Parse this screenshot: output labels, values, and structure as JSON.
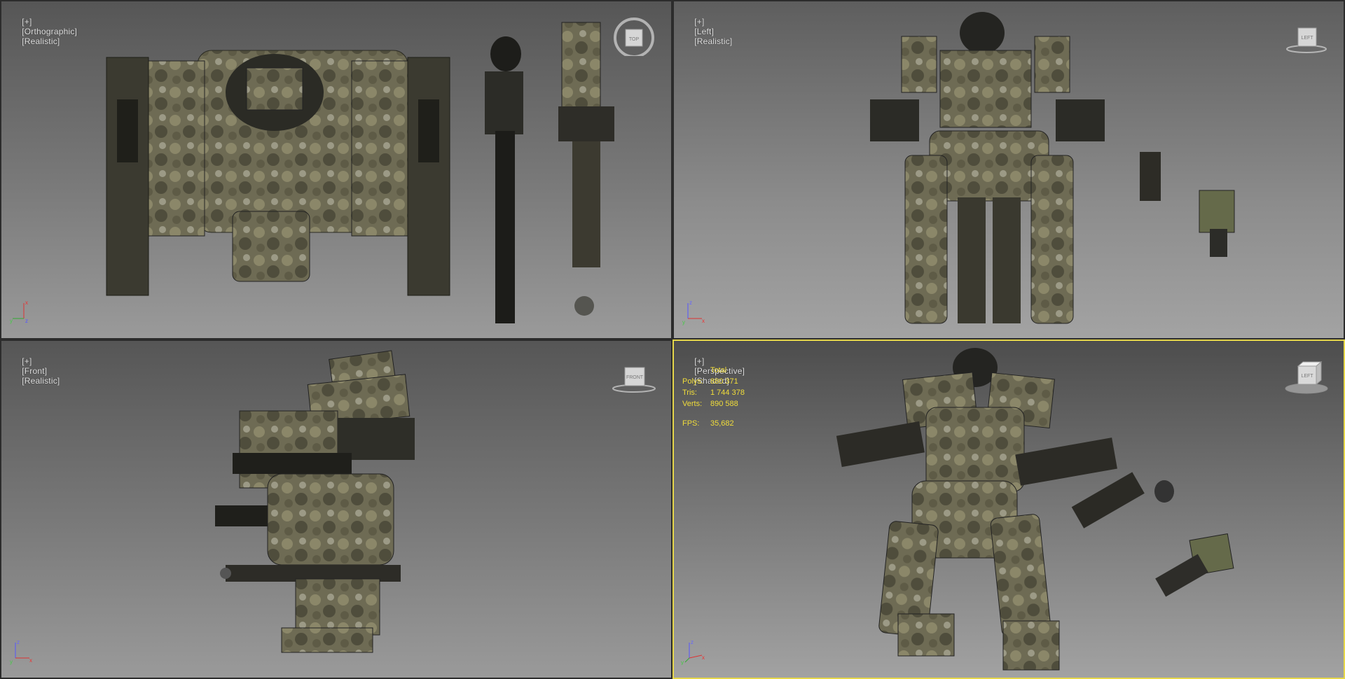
{
  "viewports": [
    {
      "id": "top-left",
      "plus": "[+]",
      "view": "[Orthographic]",
      "shading": "[Realistic]",
      "viewcube_label": "TOP",
      "axes": {
        "a": "x",
        "b": "y",
        "c": "z"
      }
    },
    {
      "id": "top-right",
      "plus": "[+]",
      "view": "[Left]",
      "shading": "[Realistic]",
      "viewcube_label": "LEFT",
      "axes": {
        "a": "z",
        "b": "y",
        "c": "x"
      }
    },
    {
      "id": "bottom-left",
      "plus": "[+]",
      "view": "[Front]",
      "shading": "[Realistic]",
      "viewcube_label": "FRONT",
      "axes": {
        "a": "z",
        "b": "y",
        "c": "x"
      }
    },
    {
      "id": "bottom-right",
      "plus": "[+]",
      "view": "[Perspective]",
      "shading": "[Shaded]",
      "viewcube_label": "LEFT",
      "axes": {
        "a": "z",
        "b": "y",
        "c": "x"
      }
    }
  ],
  "stats": {
    "header": "Total",
    "polys_label": "Polys:",
    "polys": "880 371",
    "tris_label": "Tris:",
    "tris": "1 744 378",
    "verts_label": "Verts:",
    "verts": "890 588",
    "fps_label": "FPS:",
    "fps": "35,682"
  },
  "colors": {
    "active_border": "#e6d74a",
    "stats_text": "#f1dd3a",
    "camo_light": "#8a8a6a",
    "camo_dark": "#4a4a38"
  }
}
